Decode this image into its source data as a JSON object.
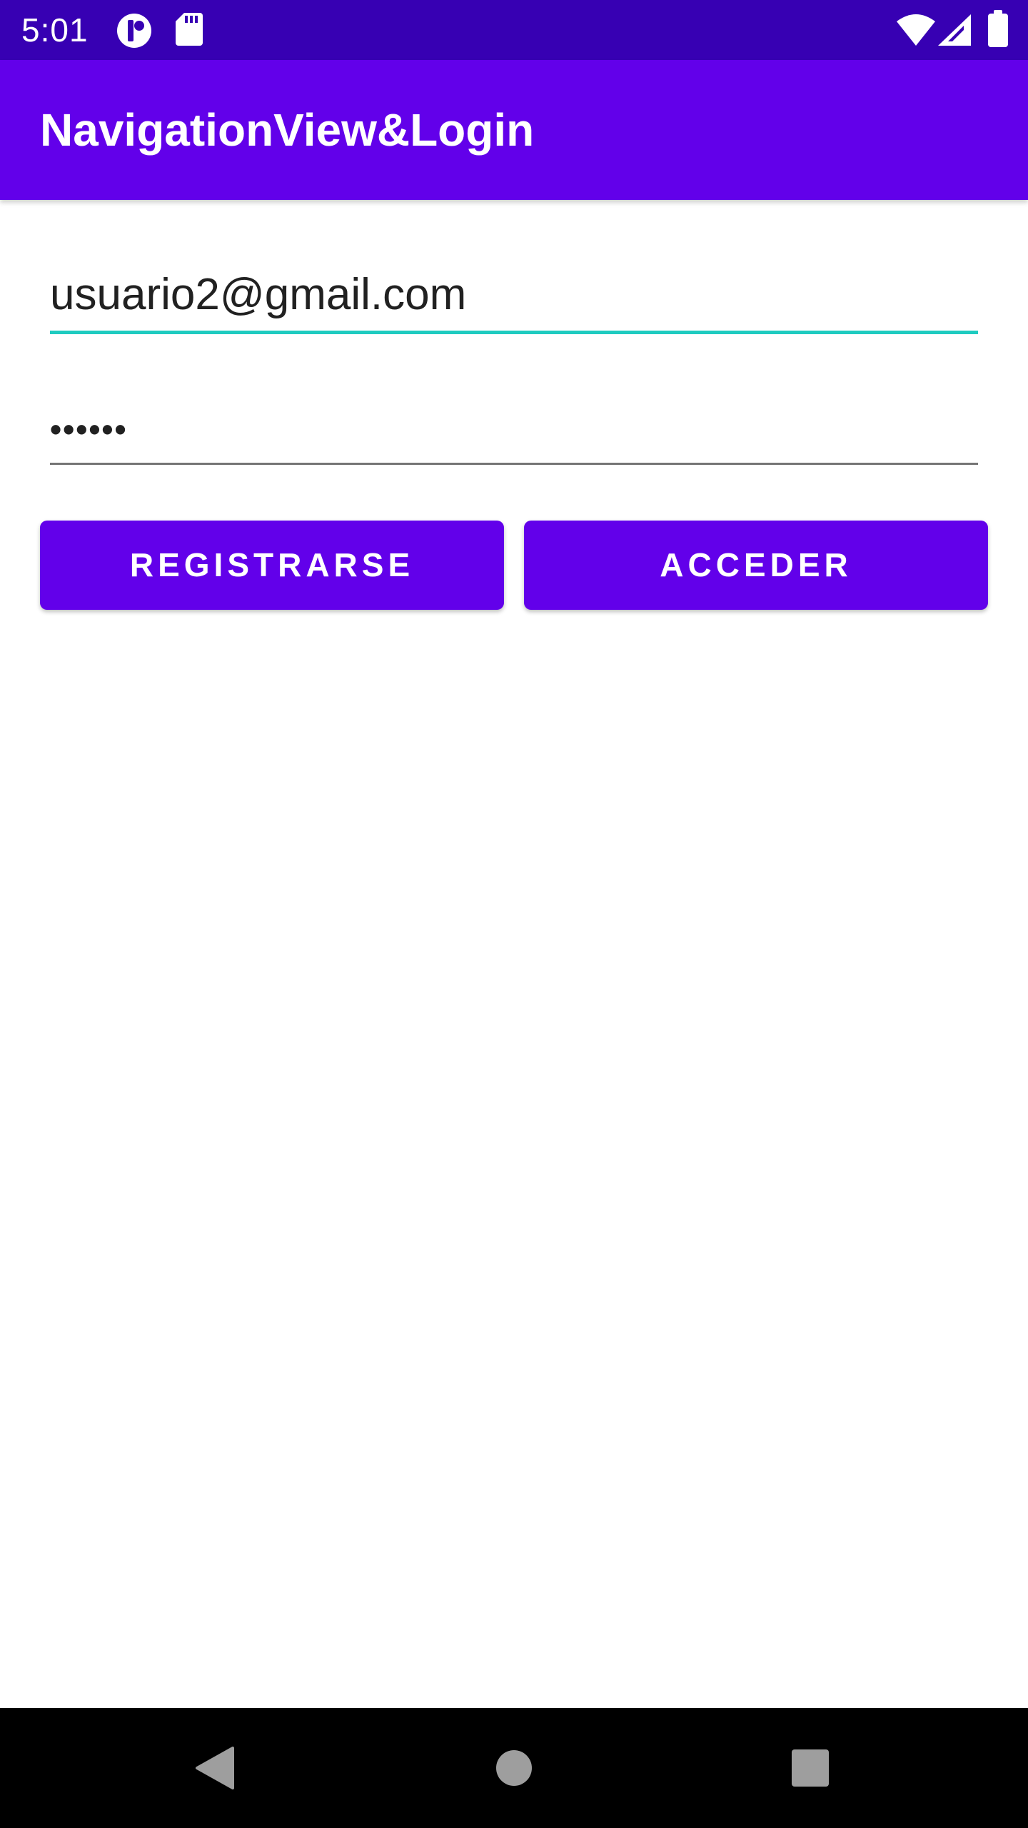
{
  "status_bar": {
    "time": "5:01",
    "icons": [
      "app-notification-icon",
      "sd-card-icon",
      "wifi-icon",
      "cell-signal-icon",
      "battery-icon"
    ],
    "background": "#3700b3"
  },
  "app_bar": {
    "title": "NavigationView&Login",
    "background": "#6200ea"
  },
  "form": {
    "email": {
      "value": "usuario2@gmail.com",
      "focused": true,
      "underline_color": "#1ecbc0"
    },
    "password": {
      "value": "••••••",
      "focused": false,
      "underline_color": "#757575"
    }
  },
  "buttons": {
    "register_label": "REGISTRARSE",
    "login_label": "ACCEDER",
    "color": "#6200ea"
  },
  "nav_bar": {
    "icons": [
      "back-icon",
      "home-icon",
      "recents-icon"
    ]
  }
}
